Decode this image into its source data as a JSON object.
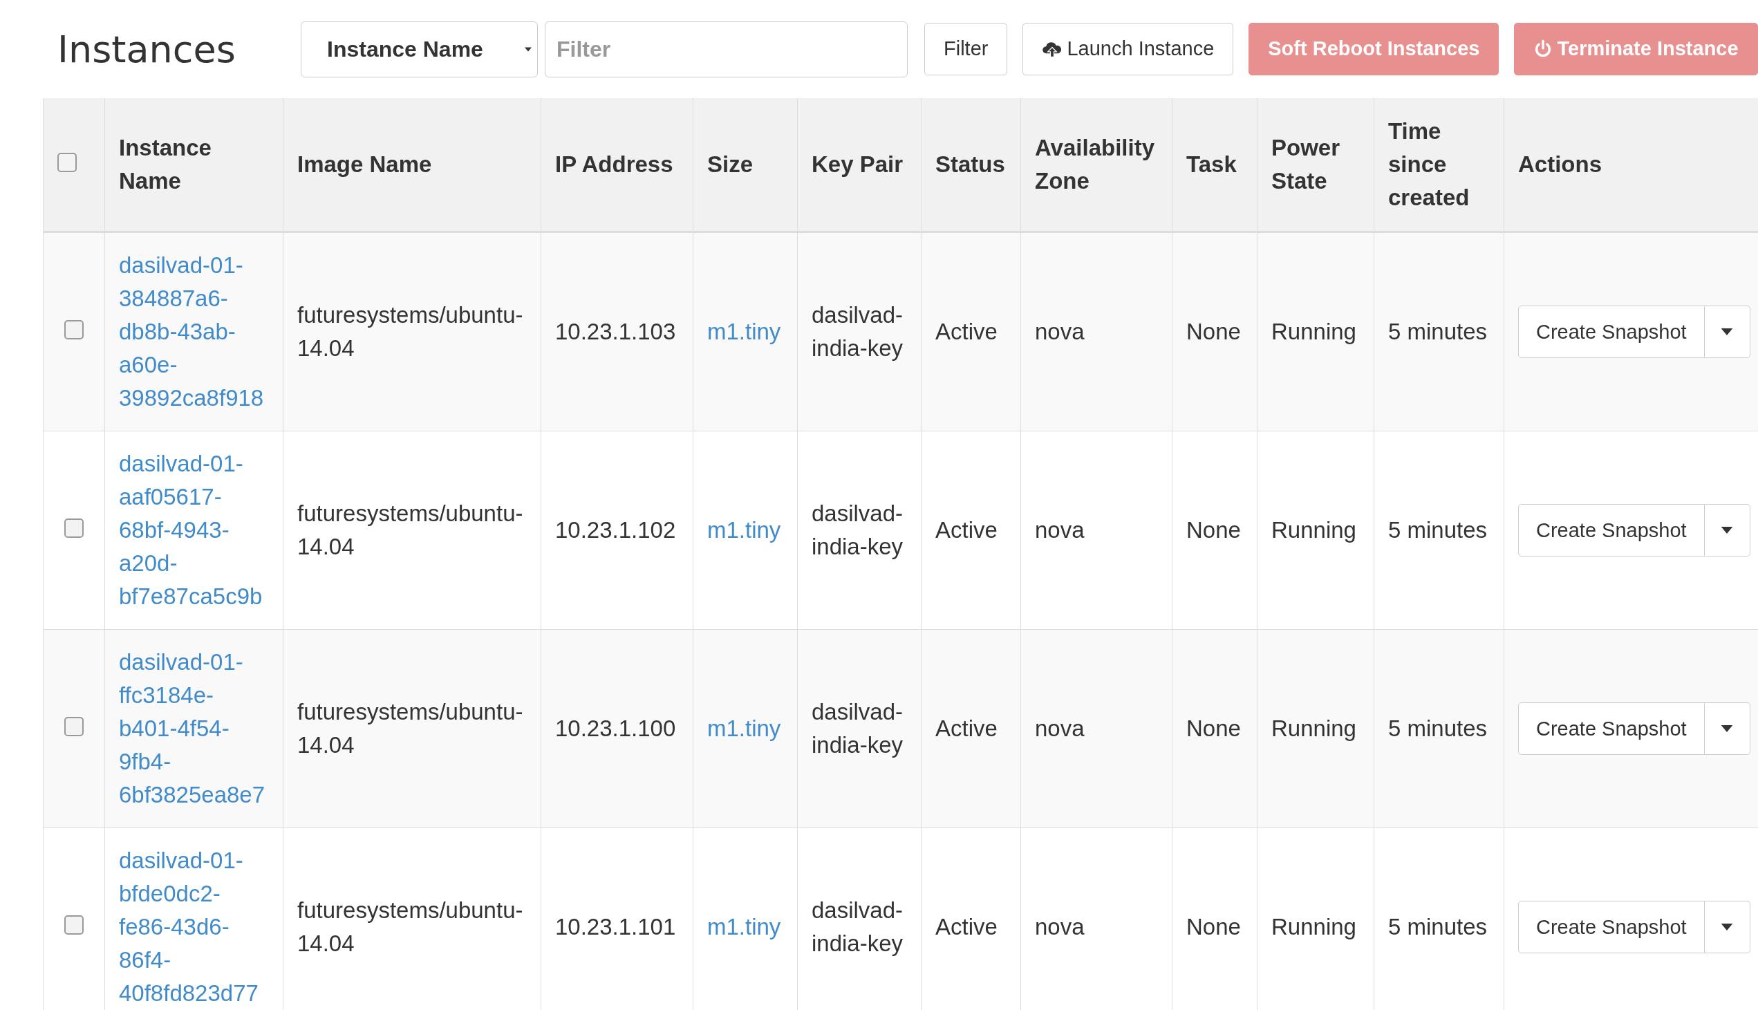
{
  "title": "Instances",
  "filter": {
    "field_select": "Instance Name",
    "placeholder": "Filter",
    "button": "Filter"
  },
  "toolbar_buttons": [
    {
      "kind": "launch",
      "label": "Launch Instance"
    },
    {
      "kind": "soft_reboot",
      "label": "Soft Reboot Instances"
    },
    {
      "kind": "terminate",
      "label": "Terminate Instance"
    }
  ],
  "table": {
    "select_all_checked": false,
    "columns": [
      "Instance Name",
      "Image Name",
      "IP Address",
      "Size",
      "Key Pair",
      "Status",
      "Availability Zone",
      "Task",
      "Power State",
      "Time since created",
      "Actions"
    ],
    "rows": [
      {
        "checked": false,
        "name": "dasilvad-01-384887a6-db8b-43ab-a60e-39892ca8f918",
        "image": "futuresystems/ubuntu-14.04",
        "ip": "10.23.1.103",
        "size": "m1.tiny",
        "key_pair": "dasilvad-india-key",
        "status": "Active",
        "zone": "nova",
        "task": "None",
        "power": "Running",
        "age": "5 minutes",
        "action": "Create Snapshot"
      },
      {
        "checked": false,
        "name": "dasilvad-01-aaf05617-68bf-4943-a20d-bf7e87ca5c9b",
        "image": "futuresystems/ubuntu-14.04",
        "ip": "10.23.1.102",
        "size": "m1.tiny",
        "key_pair": "dasilvad-india-key",
        "status": "Active",
        "zone": "nova",
        "task": "None",
        "power": "Running",
        "age": "5 minutes",
        "action": "Create Snapshot"
      },
      {
        "checked": false,
        "name": "dasilvad-01-ffc3184e-b401-4f54-9fb4-6bf3825ea8e7",
        "image": "futuresystems/ubuntu-14.04",
        "ip": "10.23.1.100",
        "size": "m1.tiny",
        "key_pair": "dasilvad-india-key",
        "status": "Active",
        "zone": "nova",
        "task": "None",
        "power": "Running",
        "age": "5 minutes",
        "action": "Create Snapshot"
      },
      {
        "checked": false,
        "name": "dasilvad-01-bfde0dc2-fe86-43d6-86f4-40f8fd823d77",
        "image": "futuresystems/ubuntu-14.04",
        "ip": "10.23.1.101",
        "size": "m1.tiny",
        "key_pair": "dasilvad-india-key",
        "status": "Active",
        "zone": "nova",
        "task": "None",
        "power": "Running",
        "age": "5 minutes",
        "action": "Create Snapshot"
      }
    ]
  }
}
